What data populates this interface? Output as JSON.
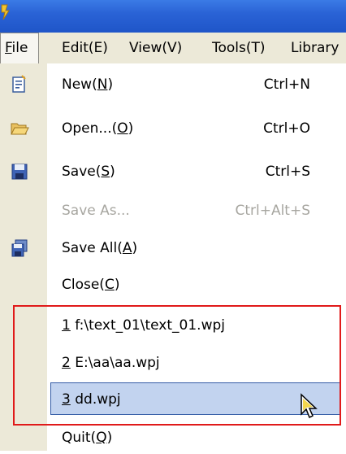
{
  "menubar": {
    "items": [
      {
        "label": "File",
        "accel": "F"
      },
      {
        "label": "Edit(E)"
      },
      {
        "label": "View(V)"
      },
      {
        "label": "Tools(T)"
      },
      {
        "label": "Library"
      }
    ]
  },
  "file_menu": {
    "items": [
      {
        "label": "New(N)",
        "shortcut": "Ctrl+N",
        "icon": "new-file-icon"
      },
      {
        "label": "Open...(O)",
        "shortcut": "Ctrl+O",
        "icon": "open-folder-icon"
      },
      {
        "label": "Save(S)",
        "shortcut": "Ctrl+S",
        "icon": "save-disk-icon"
      },
      {
        "label": "Save As...",
        "shortcut": "Ctrl+Alt+S",
        "disabled": true
      },
      {
        "label": "Save All(A)",
        "icon": "save-all-icon"
      },
      {
        "label": "Close(C)"
      }
    ],
    "recent_files": [
      {
        "num": "1",
        "path": "f:\\text_01\\text_01.wpj"
      },
      {
        "num": "2",
        "path": "E:\\aa\\aa.wpj"
      },
      {
        "num": "3",
        "path": "dd.wpj",
        "highlighted": true
      }
    ],
    "quit": {
      "label": "Quit(Q)"
    }
  },
  "colors": {
    "titlebar": "#2a63d6",
    "menubar_bg": "#ece9d8",
    "highlight_bg": "#c2d3ef",
    "highlight_border": "#355da6",
    "annotation_box": "#e01a1a",
    "disabled_text": "#a7a6a0"
  }
}
